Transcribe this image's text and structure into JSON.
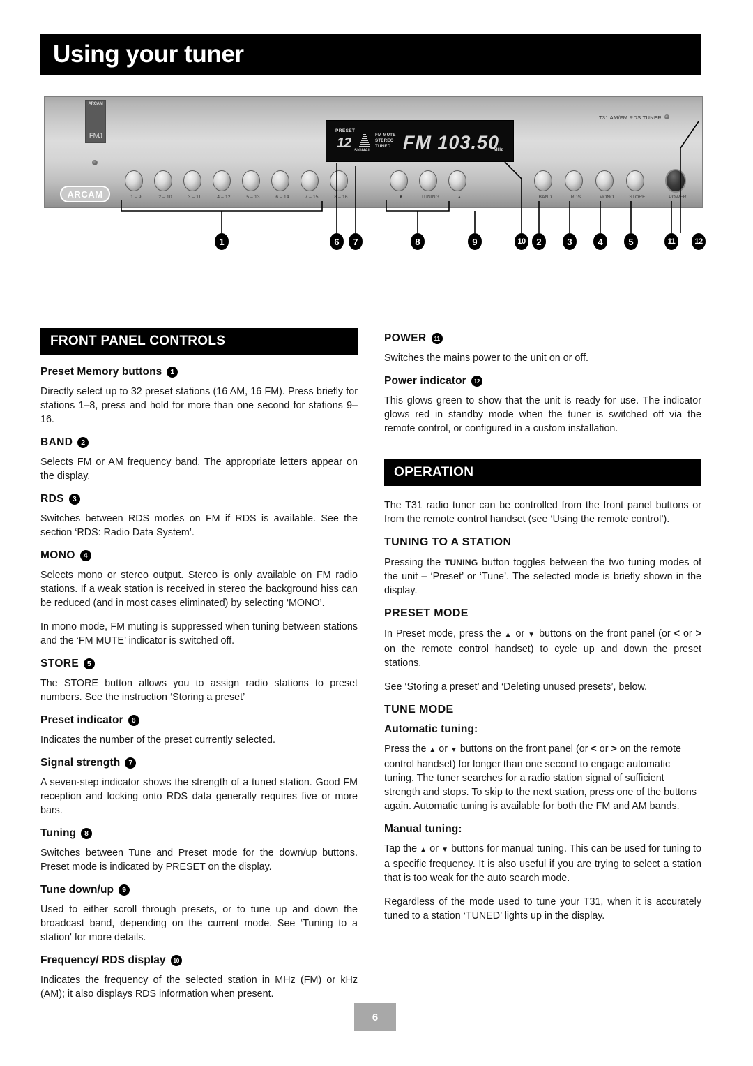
{
  "page": {
    "title": "Using your tuner",
    "number": "6"
  },
  "figure": {
    "brand_strip_top": "ARCAM",
    "brand_strip_bottom": "FMJ",
    "arcam_logo": "ARCAM",
    "model_text": "T31 AM/FM RDS TUNER",
    "display": {
      "preset_label": "PRESET",
      "preset_number": "12",
      "signal_label": "SIGNAL",
      "flag_fm_mute": "FM MUTE",
      "flag_stereo": "STEREO",
      "flag_tuned": "TUNED",
      "frequency": "FM 103.50",
      "unit": "MHz"
    },
    "preset_button_labels": [
      "1 – 9",
      "2 – 10",
      "3 – 11",
      "4 – 12",
      "5 – 13",
      "6 – 14",
      "7 – 15",
      "8 – 16"
    ],
    "tuning_button_labels": [
      "▼",
      "TUNING",
      "▲"
    ],
    "function_button_labels": [
      "BAND",
      "RDS",
      "MONO",
      "STORE"
    ],
    "power_button_label": "POWER",
    "callouts": [
      "1",
      "6",
      "7",
      "8",
      "9",
      "10",
      "2",
      "3",
      "4",
      "5",
      "11",
      "12"
    ]
  },
  "left_column": {
    "section_title": "FRONT PANEL CONTROLS",
    "preset_memory": {
      "heading": "Preset Memory buttons",
      "num": "1",
      "body": "Directly select up to 32 preset stations (16 AM, 16 FM). Press briefly for stations 1–8, press and hold for more than one second for stations 9–16."
    },
    "band": {
      "heading": "BAND",
      "num": "2",
      "body": "Selects FM or AM frequency band. The appropriate letters appear on the display."
    },
    "rds": {
      "heading": "RDS",
      "num": "3",
      "body": "Switches between RDS modes on FM if RDS is available. See the section ‘RDS: Radio Data System’."
    },
    "mono": {
      "heading": "MONO",
      "num": "4",
      "body1": "Selects mono or stereo output. Stereo is only available on FM radio stations. If a weak station is received in stereo the background hiss can be reduced (and in most cases eliminated) by selecting ‘MONO’.",
      "body2": "In mono mode, FM muting is suppressed when tuning between stations and the ‘FM MUTE’ indicator is switched off."
    },
    "store": {
      "heading": "STORE",
      "num": "5",
      "body": "The STORE button allows you to assign radio stations to preset numbers. See the instruction ‘Storing a preset’"
    },
    "preset_indicator": {
      "heading": "Preset indicator",
      "num": "6",
      "body": "Indicates the number of the preset currently selected."
    },
    "signal_strength": {
      "heading": "Signal strength",
      "num": "7",
      "body": "A seven-step indicator shows the strength of a tuned station. Good FM reception and locking onto RDS data generally requires five or more bars."
    },
    "tuning": {
      "heading": "Tuning",
      "num": "8",
      "body": "Switches between Tune and Preset mode for the down/up buttons. Preset mode is indicated by PRESET on the display."
    },
    "tune_down_up": {
      "heading": "Tune down/up",
      "num": "9",
      "body": "Used to either scroll through presets, or to tune up and down the broadcast band, depending on the current mode. See ‘Tuning to a station' for more details."
    },
    "frequency_rds_display": {
      "heading": "Frequency/ RDS display",
      "num": "10",
      "body": "Indicates the frequency of the selected station in MHz (FM) or kHz (AM); it also displays RDS information when present."
    }
  },
  "right_column": {
    "power": {
      "heading": "POWER",
      "num": "11",
      "body": "Switches the mains power to the unit on or off."
    },
    "power_indicator": {
      "heading": "Power indicator",
      "num": "12",
      "body": "This glows green to show that the unit is ready for use. The indicator glows red in standby mode when the tuner is switched off via the remote control, or configured in a custom installation."
    },
    "section_title": "OPERATION",
    "operation_intro": "The T31 radio tuner can be controlled from the front panel buttons or from the remote control handset (see ‘Using the remote control’).",
    "tuning_to_a_station": {
      "heading": "TUNING TO A STATION",
      "body_part1": "Pressing the ",
      "body_bold": "TUNING",
      "body_part2": " button toggles between the two tuning modes of the unit – ‘Preset’ or ‘Tune’. The selected mode is briefly shown in the display."
    },
    "preset_mode": {
      "heading": "PRESET MODE",
      "body1_a": "In Preset mode, press the ",
      "body1_b": " or ",
      "body1_c": " buttons on the front panel (or ",
      "body1_lt": "<",
      "body1_d": " or ",
      "body1_gt": ">",
      "body1_e": " on the remote control handset) to cycle up and down the preset stations.",
      "body2": "See ‘Storing a preset’ and ‘Deleting unused presets’, below."
    },
    "tune_mode": {
      "heading": "TUNE MODE",
      "automatic": {
        "heading": "Automatic tuning:",
        "body_a": "Press the ",
        "body_b": " or ",
        "body_c": " buttons on the front panel (or ",
        "body_lt": "<",
        "body_d": " or ",
        "body_gt": ">",
        "body_e": " on the remote control handset) for longer than one second to engage automatic tuning. The tuner searches for a radio station signal of sufficient strength and stops. To skip to the next station, press one of the buttons again. Automatic tuning is available for both the FM and AM bands."
      },
      "manual": {
        "heading": "Manual tuning:",
        "body1_a": "Tap the ",
        "body1_b": " or ",
        "body1_c": " buttons for manual tuning. This can be used for tuning to a specific frequency. It is also useful if you are trying to select a station that is too weak for the auto search mode.",
        "body2": "Regardless of the mode used to tune your T31, when it is accurately tuned to a station ‘TUNED’ lights up in the display."
      }
    }
  }
}
